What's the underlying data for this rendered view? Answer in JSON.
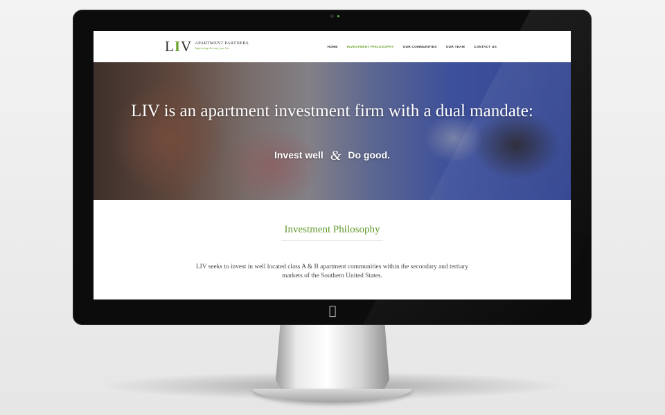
{
  "site": {
    "logo": {
      "mark_left": "L",
      "mark_bar": "I",
      "mark_right": "V",
      "name": "APARTMENT PARTNERS",
      "tagline": "Improving the way you live"
    },
    "nav": [
      {
        "label": "HOME",
        "active": false
      },
      {
        "label": "INVESTMENT PHILOSOPHY",
        "active": true
      },
      {
        "label": "OUR COMMUNITIES",
        "active": false
      },
      {
        "label": "OUR TEAM",
        "active": false
      },
      {
        "label": "CONTACT US",
        "active": false
      }
    ],
    "hero": {
      "headline": "LIV is an apartment investment firm with a dual mandate:",
      "sub_left": "Invest well",
      "sub_amp": "&",
      "sub_right": "Do good."
    },
    "section": {
      "title": "Investment Philosophy",
      "body": "LIV seeks to invest in well located class A & B apartment communities within the secondary and tertiary markets of the Southern United States."
    }
  },
  "colors": {
    "accent": "#6aa12a",
    "monitor_bezel": "#0c0c0c",
    "background": "#eeeeee"
  },
  "icons": {
    "scroll": "chevron-down-icon",
    "brand": "apple-logo-icon"
  }
}
